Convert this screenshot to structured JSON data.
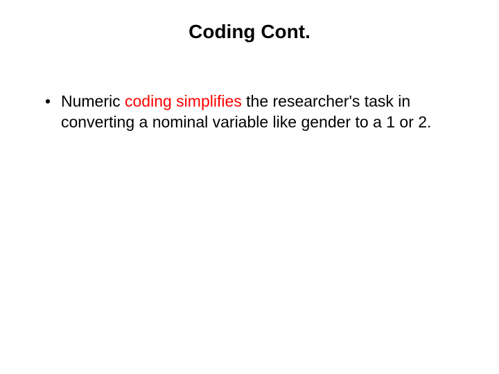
{
  "slide": {
    "title": "Coding Cont.",
    "bullet": {
      "pre": "Numeric ",
      "highlight": "coding simplifies",
      "post": " the researcher's task in converting a nominal variable like gender to a 1 or 2."
    }
  }
}
